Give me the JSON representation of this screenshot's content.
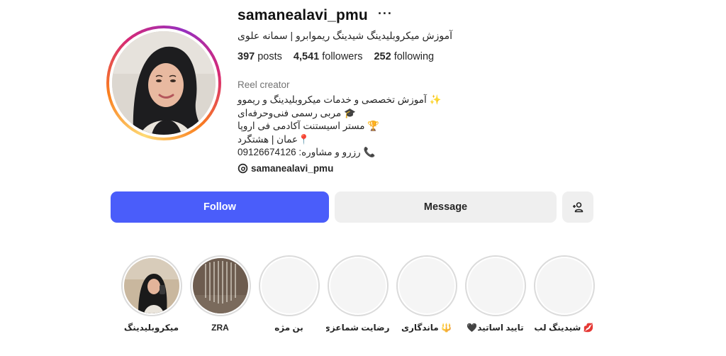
{
  "profile": {
    "username": "samanealavi_pmu",
    "more_glyph": "···",
    "full_name": "آموزش میکروبلیدینگ شیدینگ ریموابرو | سمانه علوی",
    "stats": {
      "posts_count": "397",
      "posts_label": "posts",
      "followers_count": "4,541",
      "followers_label": "followers",
      "following_count": "252",
      "following_label": "following"
    },
    "category": "Reel creator",
    "bio": [
      {
        "icon": "sparkles-icon",
        "emoji": "✨",
        "text": "آموزش تخصصی و خدمات میکروبلیدینگ و ریموو"
      },
      {
        "icon": "graduation-cap-icon",
        "emoji": "🎓",
        "text": "مربی رسمی فنی‌وحرفه‌ای"
      },
      {
        "icon": "trophy-icon",
        "emoji": "🏆",
        "text": "مستر اسیستنت آکادمی فی اروپا"
      },
      {
        "icon": "pin-icon",
        "emoji": "📍",
        "text": "عمان | هشتگرد"
      },
      {
        "icon": "phone-icon",
        "emoji": "📞",
        "text": "رزرو و مشاوره: 09126674126"
      }
    ],
    "threads_handle": "samanealavi_pmu"
  },
  "actions": {
    "follow_label": "Follow",
    "message_label": "Message",
    "suggest_icon": "add-person-icon"
  },
  "highlights": [
    {
      "label": "میکروبلیدینگ",
      "image": "photo-woman"
    },
    {
      "label": "ZRA",
      "image": "photo-chandelier"
    },
    {
      "label": "بن مژه",
      "image": "blank"
    },
    {
      "label": "رضایت شماعزی...",
      "image": "blank"
    },
    {
      "label": "🔱 ماندگاری",
      "image": "blank"
    },
    {
      "label": "تایید اساتید🖤",
      "image": "blank"
    },
    {
      "label": "💋 شیدینگ لب",
      "image": "blank"
    }
  ],
  "colors": {
    "follow_bg": "#4a5dfa",
    "secondary_bg": "#efefef",
    "muted_text": "#737373"
  }
}
